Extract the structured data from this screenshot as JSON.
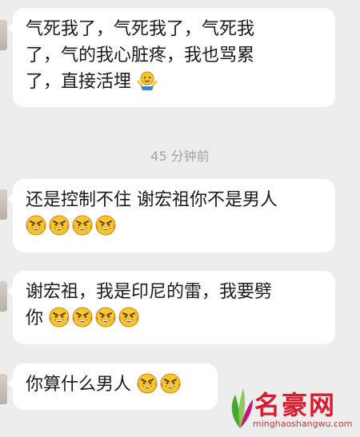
{
  "chat": {
    "messages": [
      {
        "lines": [
          "气死我了，气死我了，气死我",
          "了，气的我心脏疼，我也骂累",
          "了，直接活埋"
        ],
        "emojis": [
          "shrug"
        ]
      },
      {
        "lines": [
          "还是控制不住 谢宏祖你不是男人"
        ],
        "emojis": [
          "angry",
          "angry",
          "angry",
          "angry"
        ]
      },
      {
        "lines": [
          "谢宏祖，我是印尼的雷，我要劈",
          "你"
        ],
        "emojis": [
          "angry",
          "angry",
          "angry",
          "angry"
        ]
      },
      {
        "lines": [
          "你算什么男人"
        ],
        "emojis": [
          "angry",
          "angry"
        ]
      }
    ],
    "timestamp": "45 分钟前"
  },
  "watermark": {
    "brand": "名豪网",
    "url": "minghaoshangwu.com",
    "colors": {
      "red": "#e0192d",
      "green": "#46a832",
      "magenta": "#c2187a"
    }
  },
  "colors": {
    "background": "#ededed",
    "bubble": "#ffffff",
    "text": "#1a1a1a",
    "timestamp": "#a3a3a3",
    "emoji_face": "#f8c52d"
  }
}
